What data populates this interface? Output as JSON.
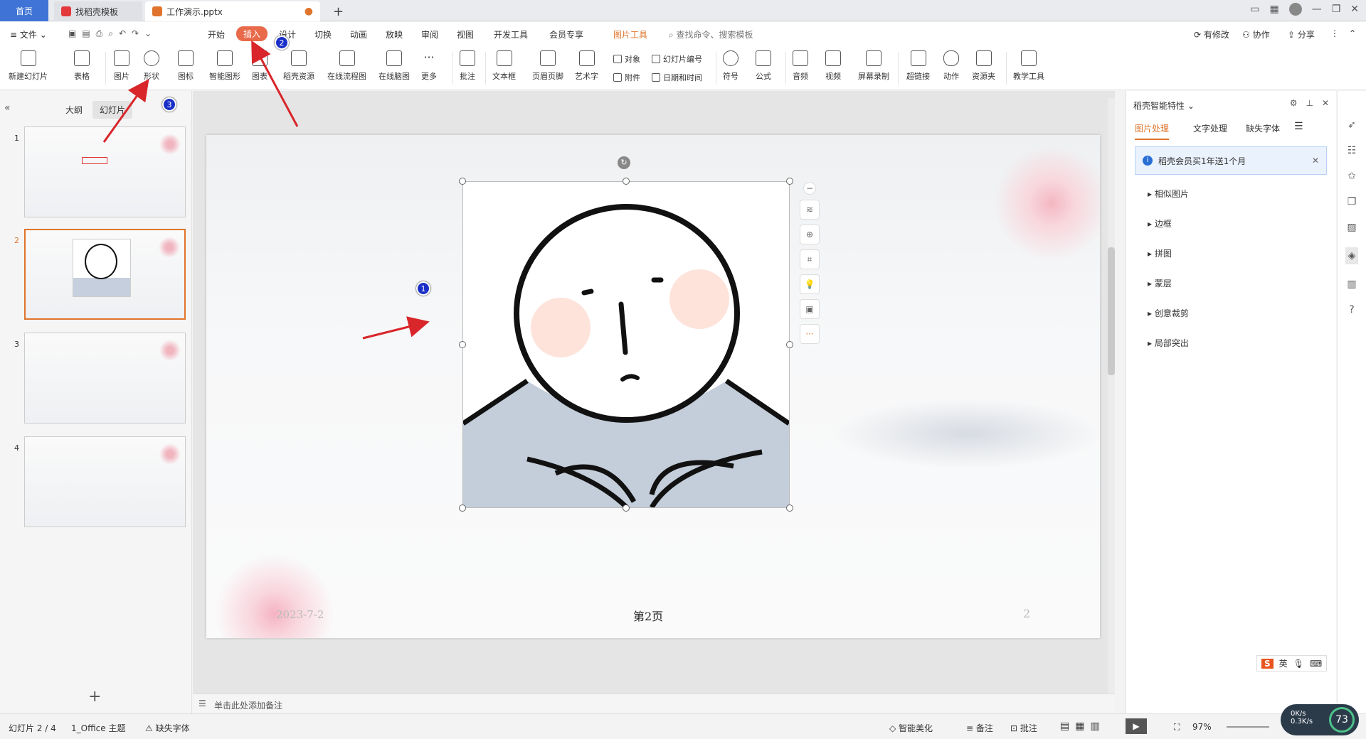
{
  "titlebar": {
    "tabs": [
      {
        "label": "首页"
      },
      {
        "label": "找稻壳模板"
      },
      {
        "label": "工作演示.pptx"
      }
    ],
    "new_tab": "+"
  },
  "menubar": {
    "file": "文件",
    "items": [
      "开始",
      "插入",
      "设计",
      "切换",
      "动画",
      "放映",
      "审阅",
      "视图",
      "开发工具",
      "会员专享",
      "图片工具"
    ],
    "search": "查找命令、搜索模板",
    "right": [
      "有修改",
      "协作",
      "分享"
    ]
  },
  "ribbon": {
    "buttons": [
      "新建幻灯片",
      "表格",
      "图片",
      "形状",
      "图标",
      "智能图形",
      "图表",
      "稻壳资源",
      "在线流程图",
      "在线脑图",
      "更多",
      "批注",
      "文本框",
      "页眉页脚",
      "艺术字",
      "符号",
      "公式",
      "音频",
      "视频",
      "屏幕录制",
      "超链接",
      "动作",
      "资源夹",
      "教学工具"
    ],
    "small": [
      "对象",
      "幻灯片编号",
      "附件",
      "日期和时间"
    ]
  },
  "leftpanel": {
    "tabs": [
      "大纲",
      "幻灯片"
    ],
    "slides": [
      "1",
      "2",
      "3",
      "4"
    ],
    "add": "+"
  },
  "slide": {
    "date": "2023-7-2",
    "page_label": "第2页",
    "page_num": "2"
  },
  "rightpanel": {
    "title": "稻壳智能特性",
    "tabs": [
      "图片处理",
      "文字处理",
      "缺失字体"
    ],
    "banner": "稻壳会员买1年送1个月",
    "items": [
      "相似图片",
      "边框",
      "拼图",
      "蒙层",
      "创意裁剪",
      "局部突出"
    ]
  },
  "notes": {
    "placeholder": "单击此处添加备注"
  },
  "statusbar": {
    "slide_info": "幻灯片 2 / 4",
    "theme": "1_Office 主题",
    "missing_font": "缺失字体",
    "beautify": "智能美化",
    "notes": "备注",
    "comments": "批注",
    "zoom": "97%",
    "cpu": "73",
    "net_up": "0K/s",
    "net_down": "0.3K/s",
    "ime": "英"
  },
  "badges": [
    "1",
    "2",
    "3"
  ],
  "colors": {
    "accent": "#e0742c",
    "home_tab": "#3f73d6",
    "insert_pill": "#e86a4a",
    "badge": "#1a2fc8",
    "arrow": "#d8262a"
  }
}
